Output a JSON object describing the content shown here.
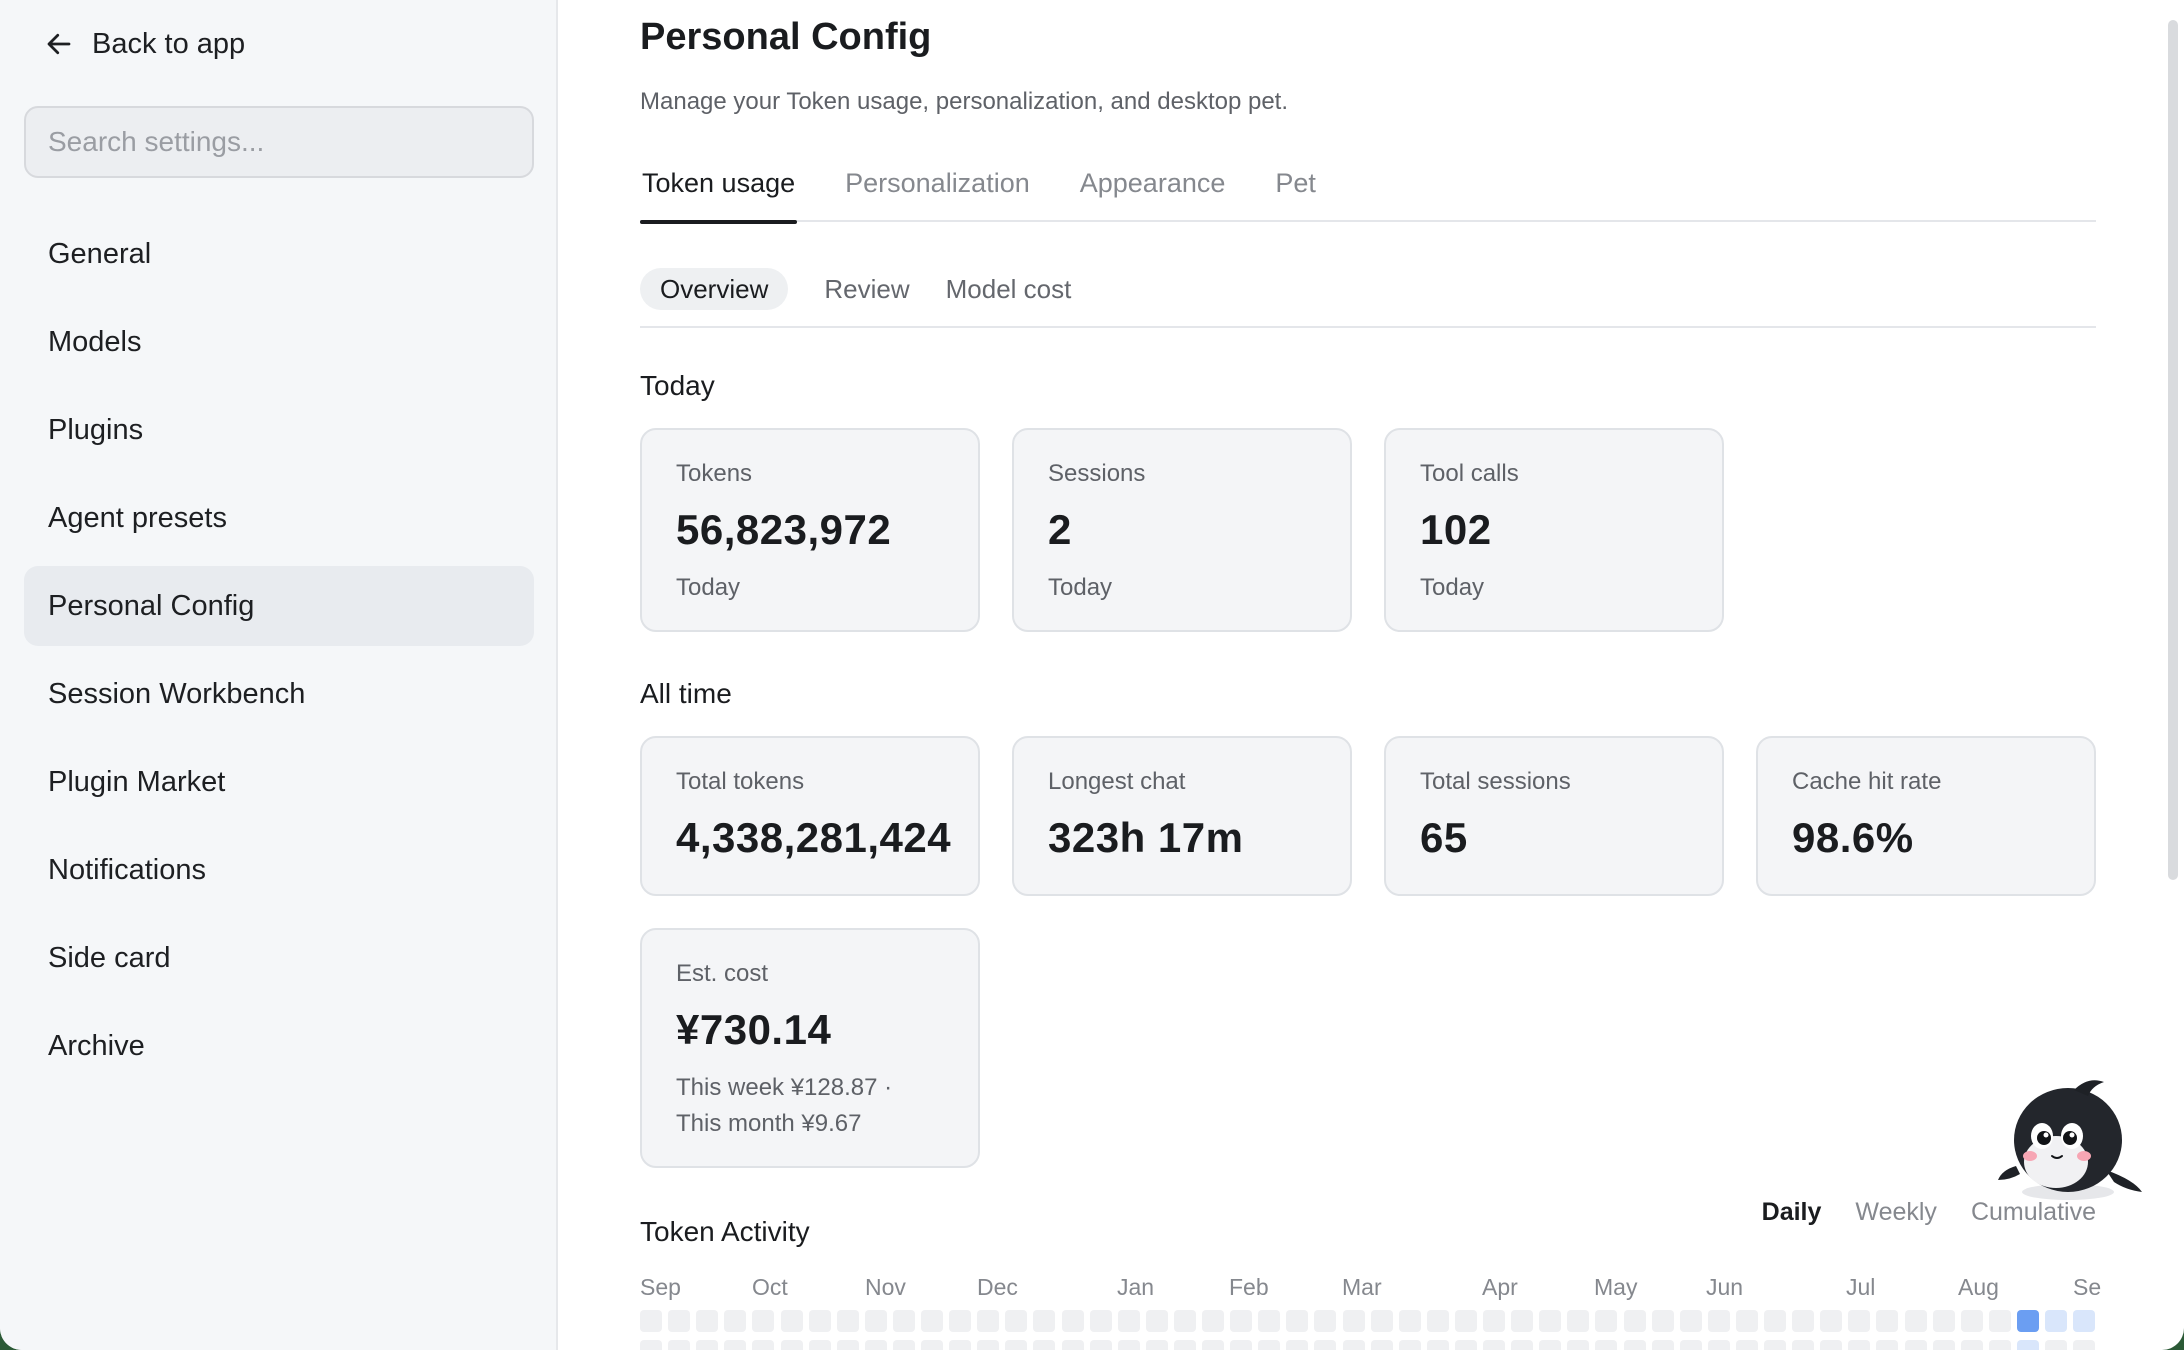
{
  "sidebar": {
    "back_label": "Back to app",
    "search_placeholder": "Search settings...",
    "items": [
      {
        "label": "General"
      },
      {
        "label": "Models"
      },
      {
        "label": "Plugins"
      },
      {
        "label": "Agent presets"
      },
      {
        "label": "Personal Config",
        "active": true
      },
      {
        "label": "Session Workbench"
      },
      {
        "label": "Plugin Market"
      },
      {
        "label": "Notifications"
      },
      {
        "label": "Side card"
      },
      {
        "label": "Archive"
      }
    ]
  },
  "header": {
    "title": "Personal Config",
    "subtitle": "Manage your Token usage, personalization, and desktop pet."
  },
  "tabs": [
    {
      "label": "Token usage",
      "active": true
    },
    {
      "label": "Personalization"
    },
    {
      "label": "Appearance"
    },
    {
      "label": "Pet"
    }
  ],
  "subtabs": [
    {
      "label": "Overview",
      "active": true
    },
    {
      "label": "Review"
    },
    {
      "label": "Model cost"
    }
  ],
  "today": {
    "title": "Today",
    "cards": [
      {
        "label": "Tokens",
        "value": "56,823,972",
        "note": "Today"
      },
      {
        "label": "Sessions",
        "value": "2",
        "note": "Today"
      },
      {
        "label": "Tool calls",
        "value": "102",
        "note": "Today"
      }
    ]
  },
  "all_time": {
    "title": "All time",
    "cards": [
      {
        "label": "Total tokens",
        "value": "4,338,281,424"
      },
      {
        "label": "Longest chat",
        "value": "323h 17m"
      },
      {
        "label": "Total sessions",
        "value": "65"
      },
      {
        "label": "Cache hit rate",
        "value": "98.6%"
      }
    ],
    "cost": {
      "label": "Est. cost",
      "value": "¥730.14",
      "note_line1": "This week ¥128.87 ·",
      "note_line2": "This month ¥9.67"
    }
  },
  "activity": {
    "title": "Token Activity",
    "views": [
      {
        "label": "Daily",
        "active": true
      },
      {
        "label": "Weekly"
      },
      {
        "label": "Cumulative"
      }
    ],
    "months": [
      "Sep",
      "Oct",
      "Nov",
      "Dec",
      "Jan",
      "Feb",
      "Mar",
      "Apr",
      "May",
      "Jun",
      "Jul",
      "Aug",
      "Se"
    ],
    "empty_color": "#eff0f2",
    "active_colors": [
      "#6b9ef2",
      "#d9e6fb"
    ]
  },
  "colors": {
    "accent": "#1a1c1f",
    "sidebar_bg": "#f5f7f9",
    "card_bg": "#f4f5f7"
  }
}
